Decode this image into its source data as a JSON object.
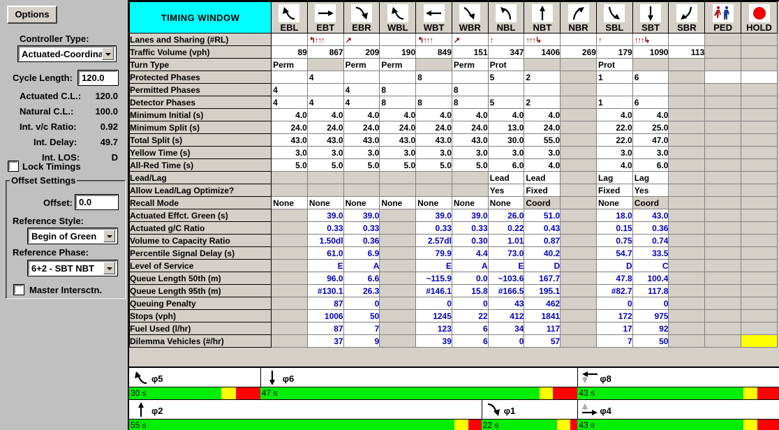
{
  "left_panel": {
    "options_button": "Options",
    "controller_type_label": "Controller Type:",
    "controller_type_value": "Actuated-Coordinated",
    "cycle_length_label": "Cycle Length:",
    "cycle_length_value": "120.0",
    "actuated_cl_label": "Actuated C.L.:",
    "actuated_cl_value": "120.0",
    "natural_cl_label": "Natural C.L.:",
    "natural_cl_value": "100.0",
    "vc_ratio_label": "Int. v/c Ratio:",
    "vc_ratio_value": "0.92",
    "int_delay_label": "Int. Delay:",
    "int_delay_value": "49.7",
    "int_los_label": "Int. LOS:",
    "int_los_value": "D",
    "lock_timings_label": "Lock Timings",
    "offset_settings_title": "Offset Settings",
    "offset_label": "Offset:",
    "offset_value": "0.0",
    "reference_style_label": "Reference Style:",
    "reference_style_value": "Begin of Green",
    "reference_phase_label": "Reference Phase:",
    "reference_phase_value": "6+2 - SBT NBT",
    "master_intersection_label": "Master Intersctn."
  },
  "grid": {
    "title": "TIMING WINDOW",
    "columns": [
      {
        "key": "EBL",
        "label": "EBL",
        "icon": "arrow-left-turn-up"
      },
      {
        "key": "EBT",
        "label": "EBT",
        "icon": "arrow-right"
      },
      {
        "key": "EBR",
        "label": "EBR",
        "icon": "arrow-right-turn-down"
      },
      {
        "key": "WBL",
        "label": "WBL",
        "icon": "arrow-left-turn-down"
      },
      {
        "key": "WBT",
        "label": "WBT",
        "icon": "arrow-left"
      },
      {
        "key": "WBR",
        "label": "WBR",
        "icon": "arrow-left-turn-up2"
      },
      {
        "key": "NBL",
        "label": "NBL",
        "icon": "arrow-up-turn-left"
      },
      {
        "key": "NBT",
        "label": "NBT",
        "icon": "arrow-up"
      },
      {
        "key": "NBR",
        "label": "NBR",
        "icon": "arrow-up-turn-right"
      },
      {
        "key": "SBL",
        "label": "SBL",
        "icon": "arrow-down-turn-right"
      },
      {
        "key": "SBT",
        "label": "SBT",
        "icon": "arrow-down"
      },
      {
        "key": "SBR",
        "label": "SBR",
        "icon": "arrow-down-turn-left"
      },
      {
        "key": "PED",
        "label": "PED",
        "icon": "pedestrian-icon"
      },
      {
        "key": "HOLD",
        "label": "HOLD",
        "icon": "red-circle-icon"
      }
    ],
    "rows": [
      {
        "label": "Lanes and Sharing (#RL)",
        "type": "lanes",
        "values": [
          "",
          "↰↑↑↑",
          "↗",
          "",
          "↰↑↑↑",
          "↗",
          "↑",
          "↑↑↑↳",
          "",
          "↑",
          "↑↑↑↳",
          "",
          "",
          ""
        ],
        "gray": [
          false,
          false,
          false,
          false,
          false,
          false,
          false,
          false,
          false,
          false,
          false,
          false,
          true,
          true
        ]
      },
      {
        "label": "Traffic Volume (vph)",
        "type": "num",
        "values": [
          "89",
          "867",
          "209",
          "190",
          "849",
          "151",
          "347",
          "1406",
          "269",
          "179",
          "1090",
          "113",
          "",
          ""
        ],
        "gray": [
          false,
          false,
          false,
          false,
          false,
          false,
          false,
          false,
          false,
          false,
          false,
          false,
          true,
          true
        ]
      },
      {
        "label": "Turn Type",
        "type": "text",
        "values": [
          "Perm",
          "",
          "Perm",
          "Perm",
          "",
          "Perm",
          "Prot",
          "",
          "",
          "Prot",
          "",
          "",
          "",
          ""
        ],
        "gray": [
          false,
          true,
          false,
          false,
          true,
          false,
          false,
          true,
          true,
          false,
          true,
          true,
          true,
          true
        ]
      },
      {
        "label": "Protected Phases",
        "type": "text",
        "values": [
          "",
          "4",
          "",
          "",
          "8",
          "",
          "5",
          "2",
          "",
          "1",
          "6",
          "",
          "",
          ""
        ],
        "gray": [
          false,
          false,
          false,
          false,
          false,
          false,
          false,
          false,
          true,
          false,
          false,
          true,
          false,
          false
        ]
      },
      {
        "label": "Permitted Phases",
        "type": "text",
        "values": [
          "4",
          "",
          "4",
          "8",
          "",
          "8",
          "",
          "",
          "",
          "",
          "",
          "",
          "",
          ""
        ],
        "gray": [
          false,
          false,
          false,
          false,
          false,
          false,
          false,
          false,
          true,
          false,
          false,
          true,
          true,
          true
        ]
      },
      {
        "label": "Detector Phases",
        "type": "text",
        "values": [
          "4",
          "4",
          "4",
          "8",
          "8",
          "8",
          "5",
          "2",
          "",
          "1",
          "6",
          "",
          "",
          ""
        ],
        "gray": [
          false,
          false,
          false,
          false,
          false,
          false,
          false,
          false,
          true,
          false,
          false,
          true,
          true,
          true
        ]
      },
      {
        "label": "Minimum Initial (s)",
        "type": "num",
        "values": [
          "4.0",
          "4.0",
          "4.0",
          "4.0",
          "4.0",
          "4.0",
          "4.0",
          "4.0",
          "",
          "4.0",
          "4.0",
          "",
          "",
          ""
        ],
        "gray": [
          false,
          false,
          false,
          false,
          false,
          false,
          false,
          false,
          true,
          false,
          false,
          true,
          true,
          true
        ]
      },
      {
        "label": "Minimum Split (s)",
        "type": "num",
        "values": [
          "24.0",
          "24.0",
          "24.0",
          "24.0",
          "24.0",
          "24.0",
          "13.0",
          "24.0",
          "",
          "22.0",
          "25.0",
          "",
          "",
          ""
        ],
        "gray": [
          false,
          false,
          false,
          false,
          false,
          false,
          false,
          false,
          true,
          false,
          false,
          true,
          true,
          true
        ]
      },
      {
        "label": "Total Split (s)",
        "type": "num",
        "values": [
          "43.0",
          "43.0",
          "43.0",
          "43.0",
          "43.0",
          "43.0",
          "30.0",
          "55.0",
          "",
          "22.0",
          "47.0",
          "",
          "",
          ""
        ],
        "gray": [
          false,
          false,
          false,
          false,
          false,
          false,
          false,
          false,
          true,
          false,
          false,
          true,
          true,
          true
        ]
      },
      {
        "label": "Yellow Time (s)",
        "type": "num",
        "values": [
          "3.0",
          "3.0",
          "3.0",
          "3.0",
          "3.0",
          "3.0",
          "3.0",
          "3.0",
          "",
          "3.0",
          "3.0",
          "",
          "",
          ""
        ],
        "gray": [
          false,
          false,
          false,
          false,
          false,
          false,
          false,
          false,
          true,
          false,
          false,
          true,
          true,
          true
        ]
      },
      {
        "label": "All-Red Time (s)",
        "type": "num",
        "values": [
          "5.0",
          "5.0",
          "5.0",
          "5.0",
          "5.0",
          "5.0",
          "6.0",
          "4.0",
          "",
          "4.0",
          "6.0",
          "",
          "",
          ""
        ],
        "gray": [
          false,
          false,
          false,
          false,
          false,
          false,
          false,
          false,
          true,
          false,
          false,
          true,
          true,
          true
        ]
      },
      {
        "label": "Lead/Lag",
        "type": "text",
        "values": [
          "",
          "",
          "",
          "",
          "",
          "",
          "Lead",
          "Lead",
          "",
          "Lag",
          "Lag",
          "",
          "",
          ""
        ],
        "gray": [
          true,
          true,
          true,
          true,
          true,
          true,
          false,
          false,
          true,
          false,
          false,
          true,
          true,
          true
        ]
      },
      {
        "label": "Allow Lead/Lag Optimize?",
        "type": "text",
        "values": [
          "",
          "",
          "",
          "",
          "",
          "",
          "Yes",
          "Fixed",
          "",
          "Fixed",
          "Yes",
          "",
          "",
          ""
        ],
        "gray": [
          true,
          true,
          true,
          true,
          true,
          true,
          false,
          false,
          true,
          false,
          false,
          true,
          true,
          true
        ]
      },
      {
        "label": "Recall Mode",
        "type": "text",
        "values": [
          "None",
          "None",
          "None",
          "None",
          "None",
          "None",
          "None",
          "Coord",
          "",
          "None",
          "Coord",
          "",
          "",
          ""
        ],
        "gray": [
          false,
          false,
          false,
          false,
          false,
          false,
          false,
          true,
          true,
          false,
          true,
          true,
          true,
          true
        ]
      },
      {
        "label": "Actuated Effct. Green (s)",
        "type": "numblue",
        "values": [
          "",
          "39.0",
          "39.0",
          "",
          "39.0",
          "39.0",
          "26.0",
          "51.0",
          "",
          "18.0",
          "43.0",
          "",
          "",
          ""
        ],
        "gray": [
          true,
          false,
          false,
          true,
          false,
          false,
          false,
          false,
          true,
          false,
          false,
          true,
          true,
          true
        ]
      },
      {
        "label": "Actuated g/C Ratio",
        "type": "numblue",
        "values": [
          "",
          "0.33",
          "0.33",
          "",
          "0.33",
          "0.33",
          "0.22",
          "0.43",
          "",
          "0.15",
          "0.36",
          "",
          "",
          ""
        ],
        "gray": [
          true,
          false,
          false,
          true,
          false,
          false,
          false,
          false,
          true,
          false,
          false,
          true,
          true,
          true
        ]
      },
      {
        "label": "Volume to Capacity Ratio",
        "type": "numblue",
        "values": [
          "",
          "1.50dl",
          "0.36",
          "",
          "2.57dl",
          "0.30",
          "1.01",
          "0.87",
          "",
          "0.75",
          "0.74",
          "",
          "",
          ""
        ],
        "gray": [
          true,
          false,
          false,
          true,
          false,
          false,
          false,
          false,
          true,
          false,
          false,
          true,
          true,
          true
        ]
      },
      {
        "label": "Percentile Signal Delay (s)",
        "type": "numblue",
        "values": [
          "",
          "61.0",
          "6.9",
          "",
          "79.9",
          "4.4",
          "73.0",
          "40.2",
          "",
          "54.7",
          "33.5",
          "",
          "",
          ""
        ],
        "gray": [
          true,
          false,
          false,
          true,
          false,
          false,
          false,
          false,
          true,
          false,
          false,
          true,
          true,
          true
        ]
      },
      {
        "label": "Level of Service",
        "type": "numblue",
        "values": [
          "",
          "E",
          "A",
          "",
          "E",
          "A",
          "E",
          "D",
          "",
          "D",
          "C",
          "",
          "",
          ""
        ],
        "gray": [
          true,
          false,
          false,
          true,
          false,
          false,
          false,
          false,
          true,
          false,
          false,
          true,
          true,
          true
        ]
      },
      {
        "label": "Queue Length 50th (m)",
        "type": "numblue",
        "values": [
          "",
          "96.0",
          "6.6",
          "",
          "~115.9",
          "0.0",
          "~103.6",
          "167.7",
          "",
          "47.8",
          "100.4",
          "",
          "",
          ""
        ],
        "gray": [
          true,
          false,
          false,
          true,
          false,
          false,
          false,
          false,
          true,
          false,
          false,
          true,
          true,
          true
        ]
      },
      {
        "label": "Queue Length 95th (m)",
        "type": "numblue",
        "values": [
          "",
          "#130.1",
          "26.3",
          "",
          "#146.1",
          "15.8",
          "#166.5",
          "195.1",
          "",
          "#82.7",
          "117.8",
          "",
          "",
          ""
        ],
        "gray": [
          true,
          false,
          false,
          true,
          false,
          false,
          false,
          false,
          true,
          false,
          false,
          true,
          true,
          true
        ]
      },
      {
        "label": "Queuing Penalty",
        "type": "numblue",
        "values": [
          "",
          "87",
          "0",
          "",
          "0",
          "0",
          "43",
          "462",
          "",
          "0",
          "0",
          "",
          "",
          ""
        ],
        "gray": [
          true,
          false,
          false,
          true,
          false,
          false,
          false,
          false,
          true,
          false,
          false,
          true,
          true,
          true
        ]
      },
      {
        "label": "Stops (vph)",
        "type": "numblue",
        "values": [
          "",
          "1006",
          "50",
          "",
          "1245",
          "22",
          "412",
          "1841",
          "",
          "172",
          "975",
          "",
          "",
          ""
        ],
        "gray": [
          true,
          false,
          false,
          true,
          false,
          false,
          false,
          false,
          true,
          false,
          false,
          true,
          true,
          true
        ]
      },
      {
        "label": "Fuel Used (l/hr)",
        "type": "numblue",
        "values": [
          "",
          "87",
          "7",
          "",
          "123",
          "6",
          "34",
          "117",
          "",
          "17",
          "92",
          "",
          "",
          ""
        ],
        "gray": [
          true,
          false,
          false,
          true,
          false,
          false,
          false,
          false,
          true,
          false,
          false,
          true,
          true,
          true
        ]
      },
      {
        "label": "Dilemma Vehicles (#/hr)",
        "type": "numblue",
        "values": [
          "",
          "37",
          "9",
          "",
          "39",
          "6",
          "0",
          "57",
          "",
          "7",
          "50",
          "",
          "",
          ""
        ],
        "gray": [
          true,
          false,
          false,
          true,
          false,
          false,
          false,
          false,
          true,
          false,
          false,
          true,
          true,
          false
        ],
        "highlight_last": true
      }
    ]
  },
  "phase_diagram": {
    "rows": [
      {
        "phases": [
          {
            "tag": "φ5",
            "icon": "arrow-left-turn-down",
            "green_label": "30 s",
            "start": 0,
            "green_end": 158,
            "yellow_end": 183,
            "red_end": 225
          },
          {
            "tag": "φ6",
            "icon": "arrow-down",
            "green_label": "47 s",
            "start": 225,
            "green_end": 705,
            "yellow_end": 728,
            "red_end": 770
          },
          {
            "tag": "φ8",
            "icon": "arrow-left-ped",
            "green_label": "43 s",
            "start": 770,
            "green_end": 1055,
            "yellow_end": 1079,
            "red_end": 1116
          }
        ]
      },
      {
        "phases": [
          {
            "tag": "φ2",
            "icon": "arrow-up",
            "green_label": "55 s",
            "start": 0,
            "green_end": 558,
            "yellow_end": 583,
            "red_end": 605
          },
          {
            "tag": "φ1",
            "icon": "arrow-right-turn-down",
            "green_label": "22 s",
            "start": 605,
            "green_end": 735,
            "yellow_end": 758,
            "red_end": 770
          },
          {
            "tag": "φ4",
            "icon": "arrow-right-ped",
            "green_label": "43 s",
            "start": 770,
            "green_end": 1055,
            "yellow_end": 1079,
            "red_end": 1116
          }
        ]
      }
    ]
  },
  "colors": {
    "cyan_header": "#00ffff",
    "blue_text": "#0000c8",
    "green": "#00ee00",
    "yellow": "#ffff00",
    "red": "#ff0000",
    "panel": "#c0c0c0",
    "grid_gray": "#d4d0c8",
    "arrow_dark_red": "#8b0000"
  }
}
